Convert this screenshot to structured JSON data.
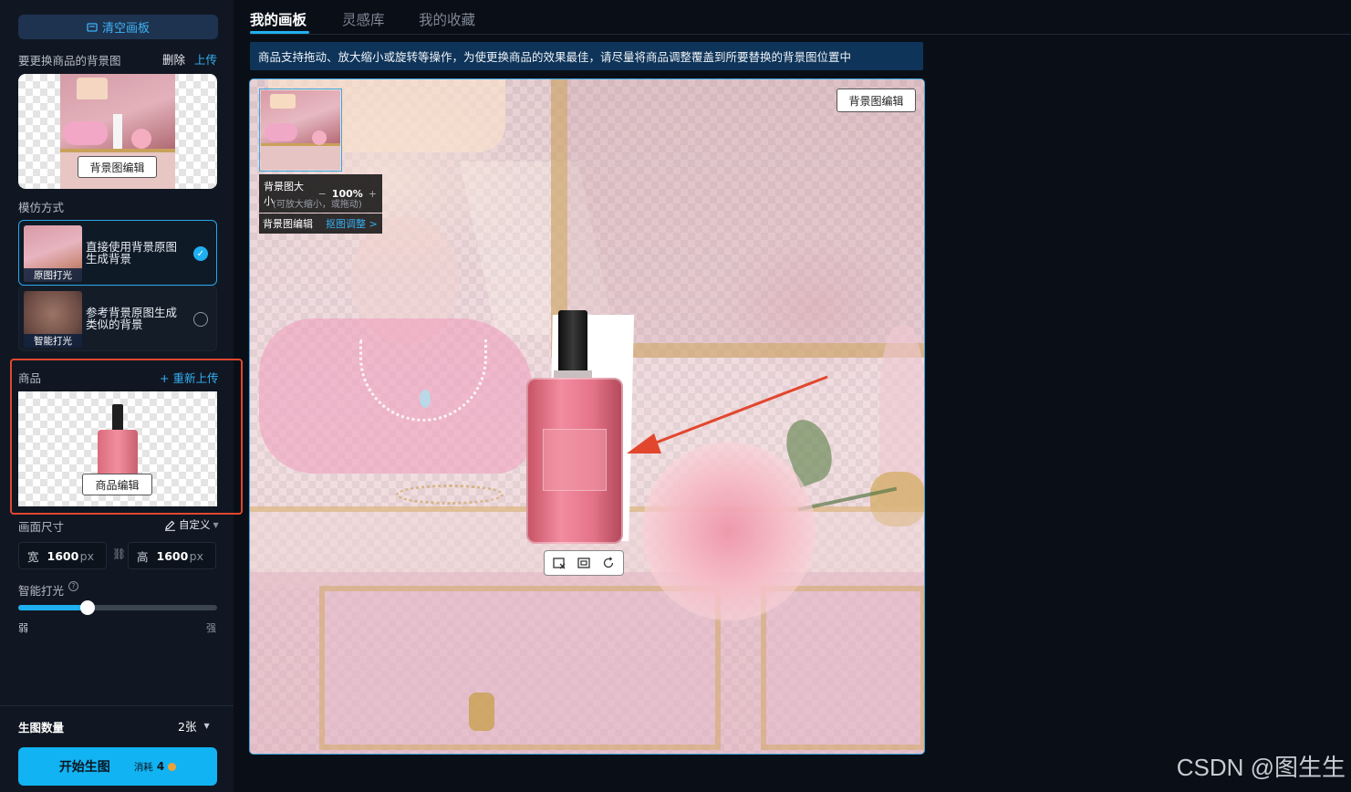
{
  "sidebar": {
    "clear_button": "清空画板",
    "background_section": {
      "label": "要更换商品的背景图",
      "delete": "删除",
      "upload": "上传",
      "edit_button": "背景图编辑"
    },
    "mode_section": {
      "label": "模仿方式",
      "options": [
        {
          "caption": "原图打光",
          "text": "直接使用背景原图生成背景",
          "selected": true
        },
        {
          "caption": "智能打光",
          "text": "参考背景原图生成类似的背景",
          "selected": false
        }
      ]
    },
    "product_section": {
      "label": "商品",
      "reupload": "+ 重新上传",
      "edit_button": "商品编辑"
    },
    "size_section": {
      "label": "画面尺寸",
      "custom": "自定义",
      "width_label": "宽",
      "width_value": "1600",
      "height_label": "高",
      "height_value": "1600",
      "unit": "px"
    },
    "lighting_section": {
      "label": "智能打光",
      "min_label": "弱",
      "max_label": "强",
      "value_fraction": 0.35
    },
    "count_section": {
      "label": "生图数量",
      "value": "2张"
    },
    "start_button": {
      "label": "开始生图",
      "cost_label": "消耗",
      "cost_value": "4"
    }
  },
  "tabs": [
    {
      "label": "我的画板",
      "active": true
    },
    {
      "label": "灵感库",
      "active": false
    },
    {
      "label": "我的收藏",
      "active": false
    }
  ],
  "notice": "商品支持拖动、放大缩小或旋转等操作，为使更换商品的效果最佳，请尽量将商品调整覆盖到所要替换的背景图位置中",
  "canvas": {
    "bg_edit_button": "背景图编辑",
    "zoom_panel": {
      "label": "背景图大小",
      "minus": "−",
      "value": "100%",
      "plus": "+",
      "hint": "(可放大缩小，或拖动)"
    },
    "edit_panel": {
      "label": "背景图编辑",
      "link": "抠图调整 >"
    }
  },
  "watermark": "CSDN @图生生",
  "colors": {
    "accent": "#1eb0f0",
    "highlight_frame": "#e2472e",
    "arrow": "#e2472e"
  }
}
